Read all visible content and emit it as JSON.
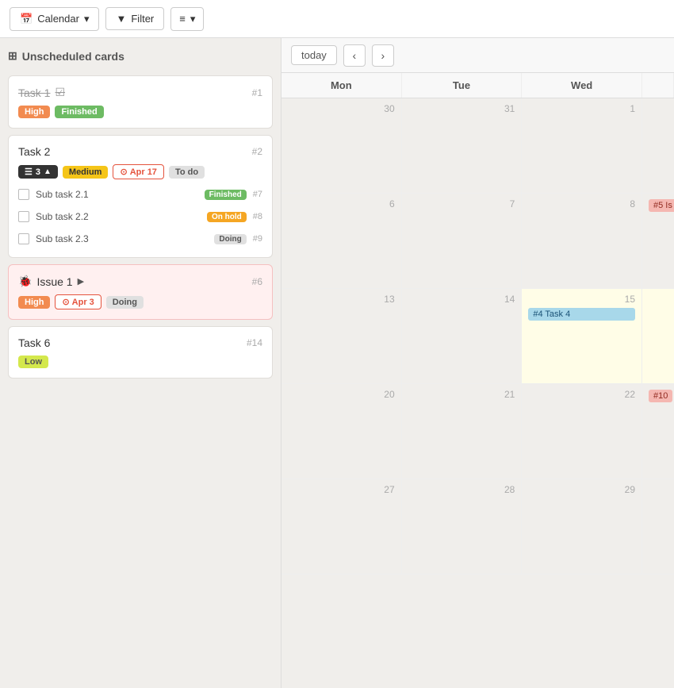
{
  "toolbar": {
    "calendar_label": "Calendar",
    "filter_label": "Filter",
    "settings_icon": "≡"
  },
  "sidebar": {
    "header": "Unscheduled cards",
    "header_icon": "⊞",
    "cards": [
      {
        "id": "card-task1",
        "title": "Task 1",
        "number": "#1",
        "strikethrough": true,
        "checkmark": true,
        "badges": [
          {
            "type": "high",
            "label": "High"
          },
          {
            "type": "finished",
            "label": "Finished"
          }
        ],
        "subtasks": []
      },
      {
        "id": "card-task2",
        "title": "Task 2",
        "number": "#2",
        "strikethrough": false,
        "badges": [
          {
            "type": "subtasks",
            "label": "3",
            "icon": "☰"
          },
          {
            "type": "medium",
            "label": "Medium"
          },
          {
            "type": "date",
            "label": "Apr 17"
          },
          {
            "type": "todo",
            "label": "To do"
          }
        ],
        "subtasks": [
          {
            "label": "Sub task 2.1",
            "badge_type": "finished",
            "badge_label": "Finished",
            "number": "#7"
          },
          {
            "label": "Sub task 2.2",
            "badge_type": "onhold",
            "badge_label": "On hold",
            "number": "#8"
          },
          {
            "label": "Sub task 2.3",
            "badge_type": "doing",
            "badge_label": "Doing",
            "number": "#9"
          }
        ]
      },
      {
        "id": "card-issue1",
        "title": "Issue 1",
        "number": "#6",
        "is_issue": true,
        "icon": "🐞",
        "has_play": true,
        "badges": [
          {
            "type": "high",
            "label": "High"
          },
          {
            "type": "date",
            "label": "Apr 3"
          },
          {
            "type": "doing",
            "label": "Doing"
          }
        ],
        "subtasks": []
      },
      {
        "id": "card-task6",
        "title": "Task 6",
        "number": "#14",
        "strikethrough": false,
        "badges": [
          {
            "type": "low",
            "label": "Low"
          }
        ],
        "subtasks": []
      }
    ]
  },
  "calendar": {
    "today_label": "today",
    "prev_icon": "‹",
    "next_icon": "›",
    "columns": [
      {
        "label": "Mon"
      },
      {
        "label": "Tue"
      },
      {
        "label": "Wed"
      },
      {
        "label": ""
      }
    ],
    "weeks": [
      {
        "days": [
          {
            "num": "30",
            "events": []
          },
          {
            "num": "31",
            "events": []
          },
          {
            "num": "1",
            "events": []
          },
          {
            "overflow": ""
          }
        ]
      },
      {
        "days": [
          {
            "num": "6",
            "events": []
          },
          {
            "num": "7",
            "events": []
          },
          {
            "num": "8",
            "events": []
          },
          {
            "overflow": "#5 Is"
          }
        ]
      },
      {
        "days": [
          {
            "num": "13",
            "events": []
          },
          {
            "num": "14",
            "events": []
          },
          {
            "num": "15",
            "events": [
              {
                "label": "#4 Task 4",
                "type": "blue"
              }
            ],
            "today": true
          },
          {
            "overflow": ""
          }
        ]
      },
      {
        "days": [
          {
            "num": "20",
            "events": []
          },
          {
            "num": "21",
            "events": []
          },
          {
            "num": "22",
            "events": []
          },
          {
            "overflow": "#10"
          }
        ]
      },
      {
        "days": [
          {
            "num": "27",
            "events": []
          },
          {
            "num": "28",
            "events": []
          },
          {
            "num": "29",
            "events": []
          },
          {
            "overflow": ""
          }
        ]
      }
    ]
  }
}
